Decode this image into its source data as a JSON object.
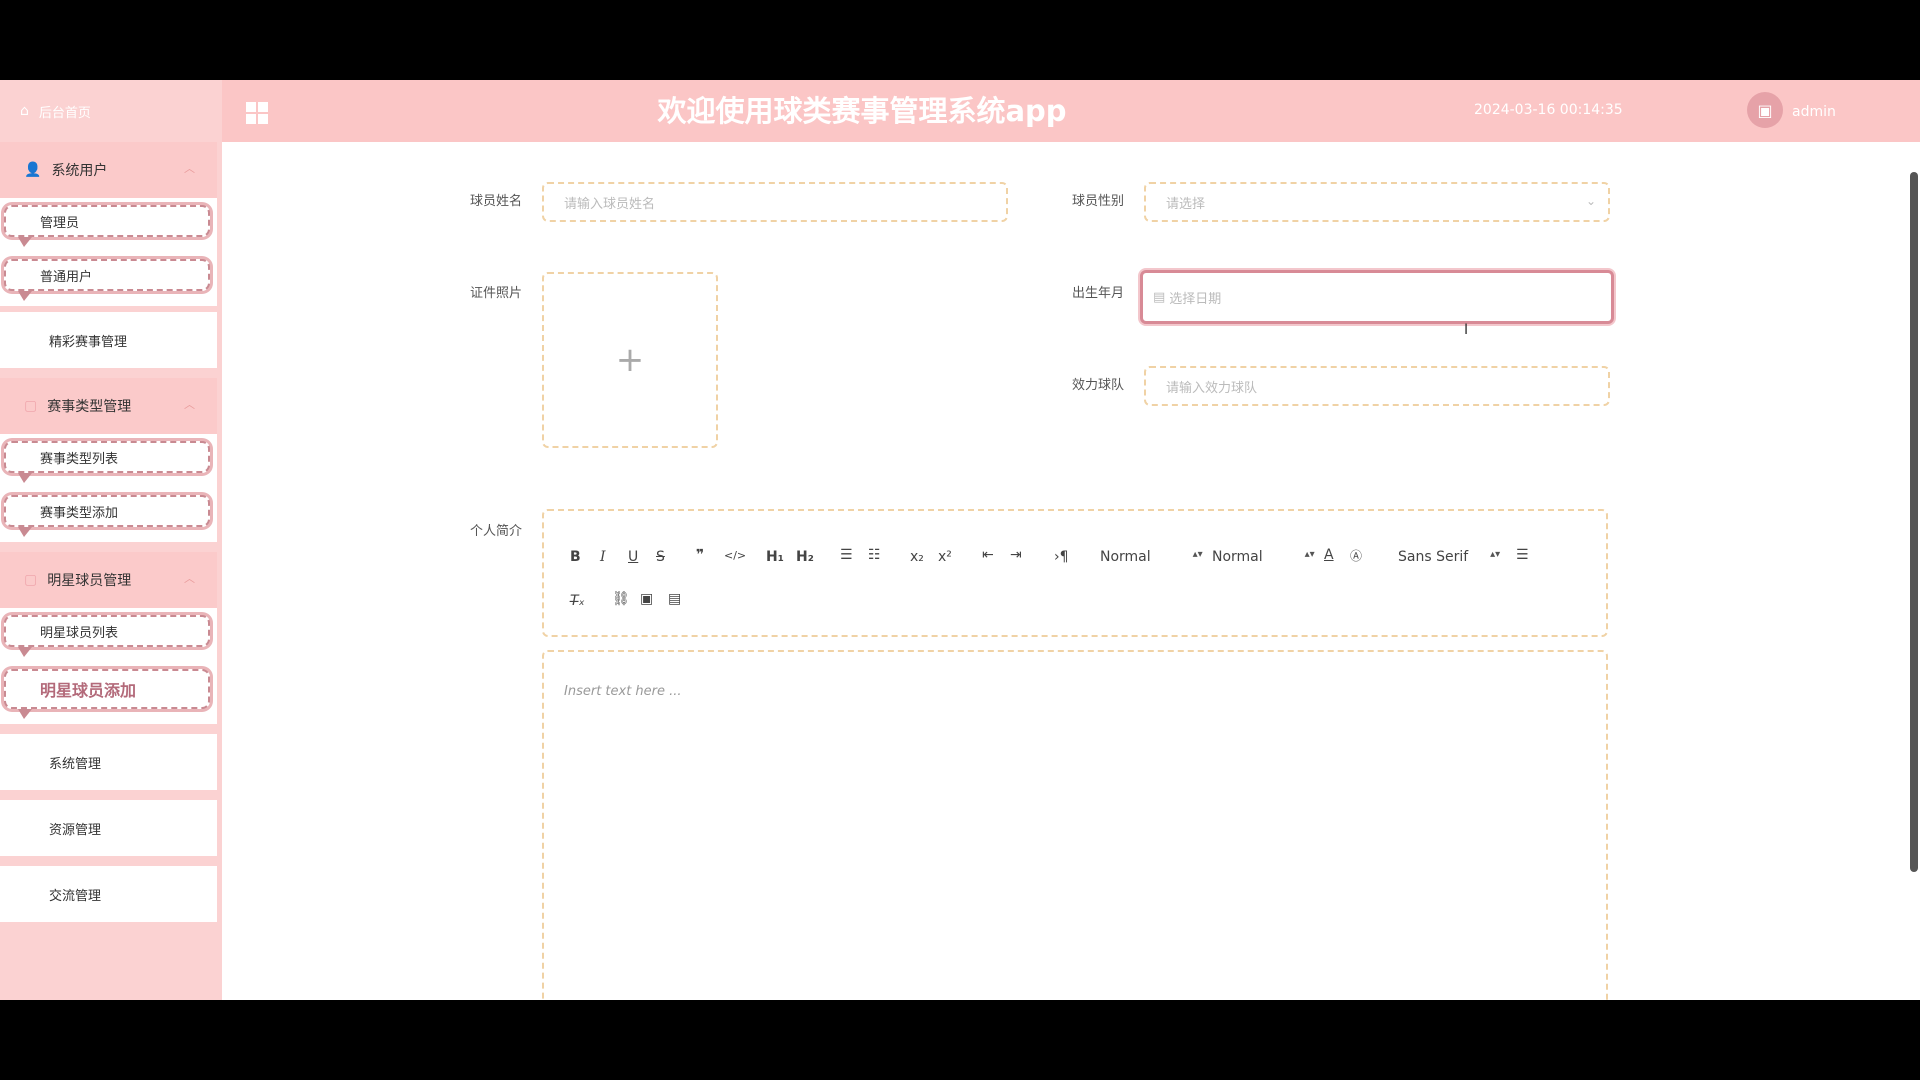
{
  "sidebar": {
    "home": "后台首页",
    "groups": [
      {
        "title": "系统用户",
        "items": [
          "管理员",
          "普通用户"
        ]
      },
      {
        "single": "精彩赛事管理"
      },
      {
        "title": "赛事类型管理",
        "items": [
          "赛事类型列表",
          "赛事类型添加"
        ]
      },
      {
        "title": "明星球员管理",
        "items": [
          "明星球员列表",
          "明星球员添加"
        ]
      }
    ],
    "bottom": [
      "系统管理",
      "资源管理",
      "交流管理"
    ]
  },
  "header": {
    "title": "欢迎使用球类赛事管理系统app",
    "datetime": "2024-03-16 00:14:35",
    "user": "admin"
  },
  "form": {
    "name_label": "球员姓名",
    "name_placeholder": "请输入球员姓名",
    "gender_label": "球员性别",
    "gender_placeholder": "请选择",
    "photo_label": "证件照片",
    "birth_label": "出生年月",
    "birth_placeholder": "选择日期",
    "team_label": "效力球队",
    "team_placeholder": "请输入效力球队",
    "bio_label": "个人简介",
    "toolbar": {
      "header_select": "Normal",
      "size_select": "Normal",
      "font_select": "Sans Serif"
    },
    "editor_placeholder": "Insert text here ..."
  },
  "colors": {
    "sidebar_bg": "#fbd2d2",
    "header_bg": "#fbc6c6",
    "accent": "#d88a96",
    "input_border": "#f0d2a5"
  }
}
